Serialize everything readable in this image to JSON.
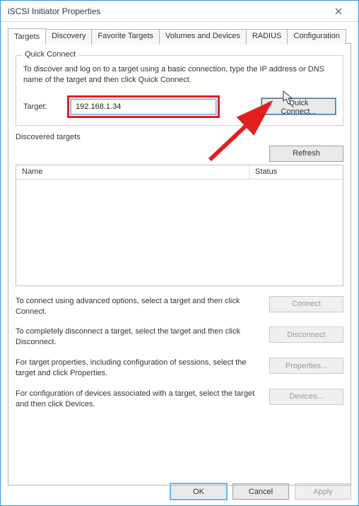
{
  "window": {
    "title": "iSCSI Initiator Properties"
  },
  "tabs": {
    "items": [
      "Targets",
      "Discovery",
      "Favorite Targets",
      "Volumes and Devices",
      "RADIUS",
      "Configuration"
    ],
    "active": 0
  },
  "quickConnect": {
    "groupTitle": "Quick Connect",
    "description": "To discover and log on to a target using a basic connection, type the IP address or DNS name of the target and then click Quick Connect.",
    "targetLabel": "Target:",
    "targetValue": "192.168.1.34",
    "buttonLabel": "Quick Connect..."
  },
  "discovered": {
    "title": "Discovered targets",
    "refresh": "Refresh",
    "columns": {
      "name": "Name",
      "status": "Status"
    }
  },
  "options": {
    "connect": {
      "text": "To connect using advanced options, select a target and then click Connect.",
      "button": "Connect"
    },
    "disconnect": {
      "text": "To completely disconnect a target, select the target and then click Disconnect.",
      "button": "Disconnect"
    },
    "properties": {
      "text": "For target properties, including configuration of sessions, select the target and click Properties.",
      "button": "Properties..."
    },
    "devices": {
      "text": "For configuration of devices associated with a target, select the target and then click Devices.",
      "button": "Devices..."
    }
  },
  "footer": {
    "ok": "OK",
    "cancel": "Cancel",
    "apply": "Apply"
  }
}
